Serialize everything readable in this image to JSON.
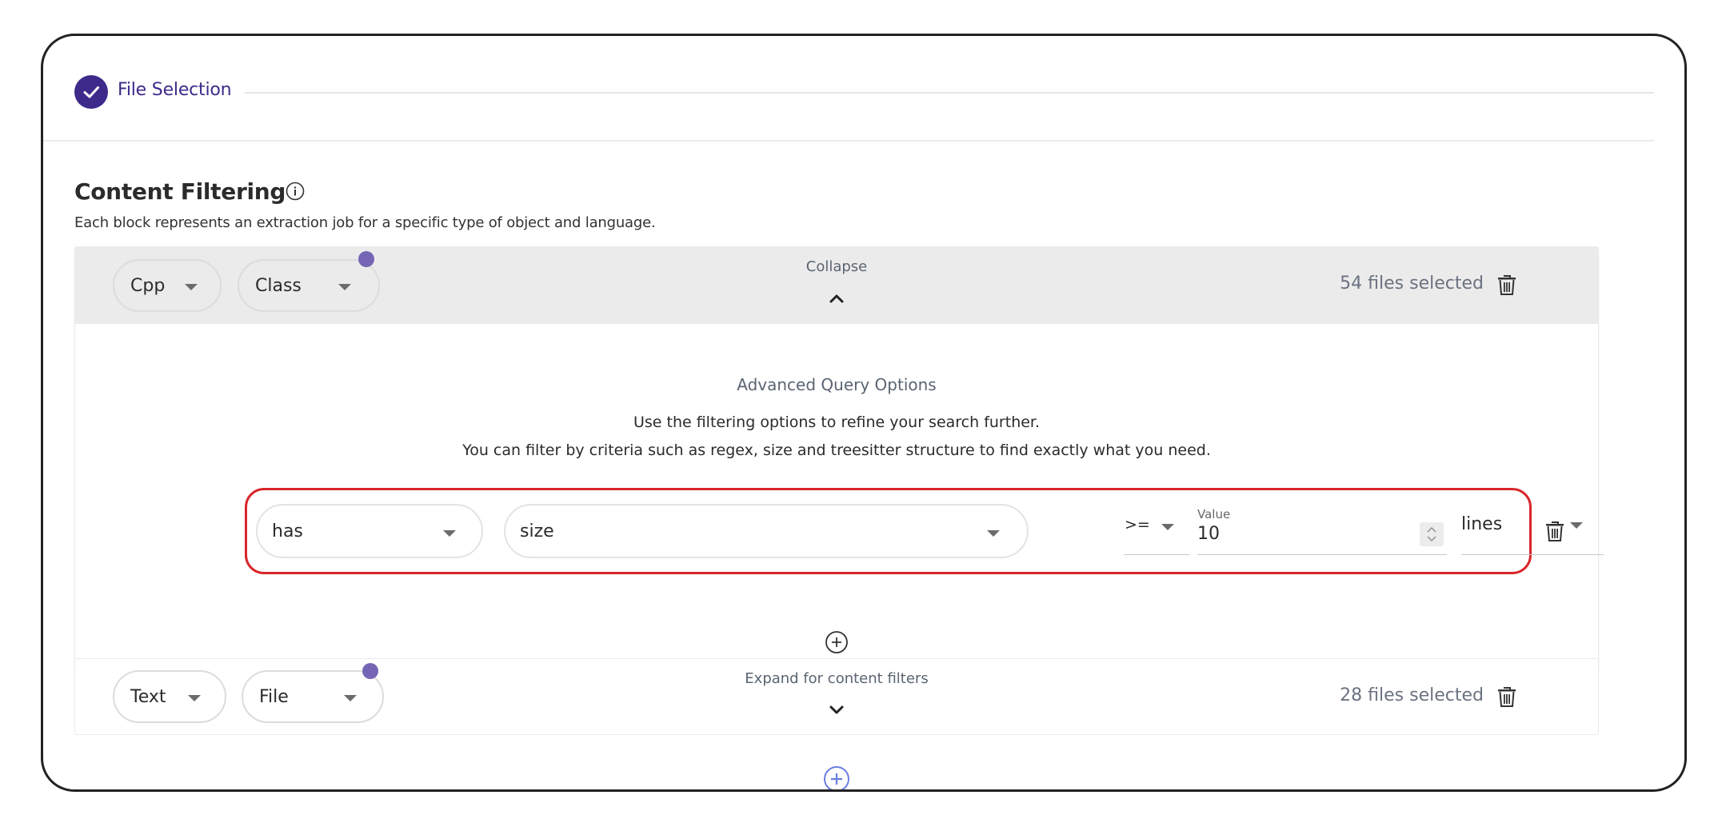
{
  "step": {
    "title": "File Selection",
    "status": "completed",
    "check_color": "#3d2a8a"
  },
  "section": {
    "title": "Content Filtering",
    "info_icon": "info-icon",
    "description": "Each block represents an extraction job for a specific type of object and language."
  },
  "blocks": [
    {
      "language": "Cpp",
      "object_type": "Class",
      "toggle_label": "Collapse",
      "toggle_icon": "chevron-up-icon",
      "expanded": true,
      "files_selected": "54 files selected",
      "advanced": {
        "title": "Advanced Query Options",
        "line1": "Use the filtering options to refine your search further.",
        "line2": "You can filter by criteria such as regex, size and treesitter structure to find exactly what you need."
      },
      "filter": {
        "predicate": "has",
        "attribute": "size",
        "operator": ">=",
        "value_label": "Value",
        "value": "10",
        "unit": "lines"
      }
    },
    {
      "language": "Text",
      "object_type": "File",
      "toggle_label": "Expand for content filters",
      "toggle_icon": "chevron-down-icon",
      "expanded": false,
      "files_selected": "28 files selected"
    }
  ],
  "colors": {
    "accent": "#3d2a8a",
    "dot": "#7566b5",
    "highlight_border": "#d8262b",
    "add_block": "#6b7fe0"
  }
}
